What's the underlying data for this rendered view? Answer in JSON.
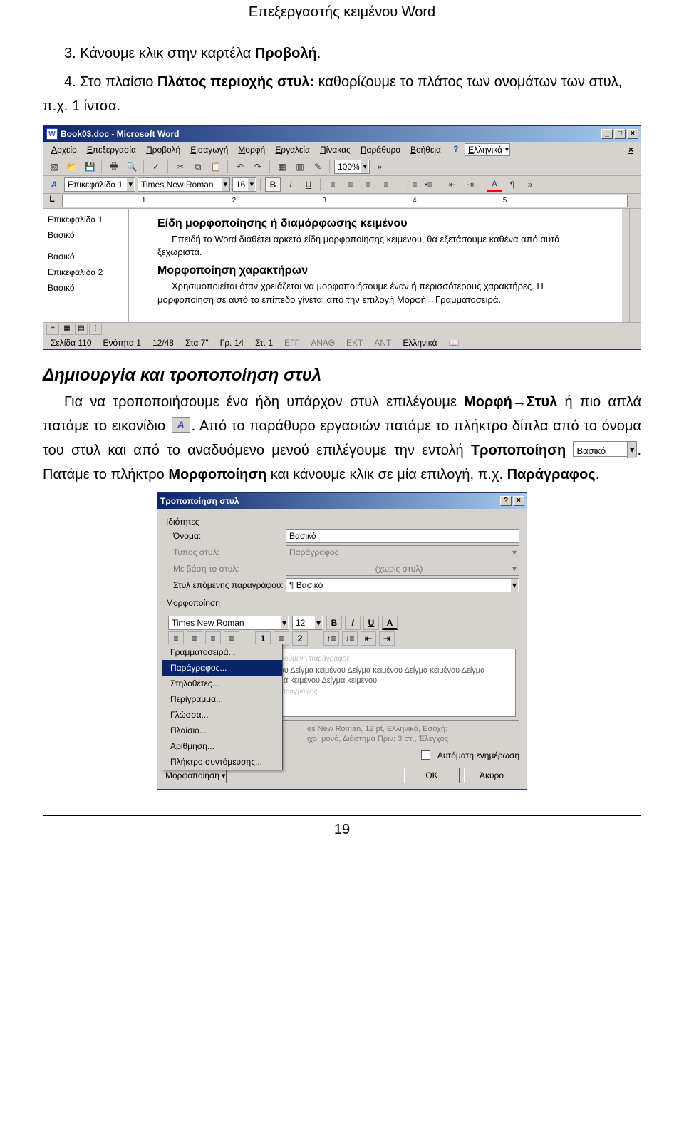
{
  "doc_header": "Επεξεργαστής κειμένου Word",
  "line1a": "3. Κάνουμε κλικ στην καρτέλα ",
  "line1b": "Προβολή",
  "line1c": ".",
  "line2a": "4. Στο πλαίσιο ",
  "line2b": "Πλάτος περιοχής στυλ:",
  "line2c": " καθορίζουμε το πλάτος των ονομάτων των στυλ, π.χ. 1 ίντσα.",
  "word_title": "Book03.doc - Microsoft Word",
  "menus": [
    "Αρχείο",
    "Επεξεργασία",
    "Προβολή",
    "Εισαγωγή",
    "Μορφή",
    "Εργαλεία",
    "Πίνακας",
    "Παράθυρο",
    "Βοήθεια"
  ],
  "menu_lang": "Ελληνικά",
  "tb1_zoom": "100%",
  "tb2_style": "Επικεφαλίδα 1",
  "tb2_font": "Times New Roman",
  "tb2_size": "16",
  "sidebar_items": [
    "Επικεφαλίδα 1",
    "Βασικό",
    "Βασικό",
    "Επικεφαλίδα 2",
    "Βασικό"
  ],
  "doc_h1": "Είδη μορφοποίησης ή διαμόρφωσης κειμένου",
  "doc_p1": "Επειδή το Word διαθέτει αρκετά είδη μορφοποίησης κειμένου, θα εξετάσουμε καθένα από αυτά ξεχωριστά.",
  "doc_h2": "Μορφοποίηση χαρακτήρων",
  "doc_p2": "Χρησιμοποιείται όταν χρειάζεται να μορφοποιήσουμε έναν ή περισσότερους χαρακτήρες. Η μορφοποίηση σε αυτό το επίπεδο γίνεται από την επιλογή Μορφή→Γραμματοσειρά.",
  "status": {
    "page": "Σελίδα 110",
    "section": "Ενότητα 1",
    "prog": "12/48",
    "at": "Στα 7\"",
    "line": "Γρ. 14",
    "col": "Στ. 1",
    "ind1": "ΕΓΓ",
    "ind2": "ΑΝΑΘ",
    "ind3": "ΕΚΤ",
    "ind4": "ΑΝΤ",
    "lang": "Ελληνικά"
  },
  "section_title": "Δημιουργία και τροποποίηση στυλ",
  "para2_a": "Για να τροποποιήσουμε ένα ήδη υπάρχον στυλ επιλέγουμε ",
  "para2_b": "Μορφή→Στυλ",
  "para2_c": " ή πιο απλά πατάμε το εικονίδιο ",
  "para2_d": ". Από το παράθυρο εργασιών πατάμε το πλήκτρο δίπλα από το όνομα του στυλ και από το αναδυόμενο μενού επιλέγουμε την εντολή ",
  "para2_e": "Τροποποίηση",
  "inline_select_value": "Βασικό",
  "para2_f": ". Πατάμε το πλήκτρο ",
  "para2_g": "Μορφοποίηση",
  "para2_h": " και κάνουμε κλικ σε μία επιλογή, π.χ. ",
  "para2_i": "Παράγραφος",
  "para2_j": ".",
  "dialog": {
    "title": "Τροποποίηση στυλ",
    "group1": "Ιδιότητες",
    "f_name_lbl": "Όνομα:",
    "f_name_val": "Βασικό",
    "f_type_lbl": "Τύπος στυλ:",
    "f_type_val": "Παράγραφος",
    "f_based_lbl": "Με βάση το στυλ:",
    "f_based_val": "(χωρίς στυλ)",
    "f_next_lbl": "Στυλ επόμενης παραγράφου:",
    "f_next_val": "¶ Βασικό",
    "group2": "Μορφοποίηση",
    "fm_font": "Times New Roman",
    "fm_size": "12",
    "menu": [
      "Γραμματοσειρά...",
      "Παράγραφος...",
      "Στηλοθέτες...",
      "Περίγραμμα...",
      "Γλώσσα...",
      "Πλαίσιο...",
      "Αρίθμηση...",
      "Πλήκτρο συντόμευσης..."
    ],
    "preview_sample": "Δείγμα κειμένου Δείγμα κειμένου Δείγμα κειμένου Δείγμα κειμένου Δείγμα κειμένου Δείγμα κειμένου Δείγμα κειμένου Δείγμα κειμένου Δείγμα κειμένου",
    "desc1": "es New Roman, 12 pt, Ελληνικά, Εσοχή:",
    "desc2": "ιχο: μονό, Διάστημα Πριν: 3 στ., Έλεγχος",
    "auto_update": "Αυτόματη ενημέρωση",
    "btn_format": "Μορφοποίηση",
    "btn_ok": "OK",
    "btn_cancel": "Άκυρο"
  },
  "page_number": "19",
  "style_icon_glyph": "A",
  "ruler_labels": [
    "1",
    "2",
    "3",
    "4",
    "5"
  ]
}
